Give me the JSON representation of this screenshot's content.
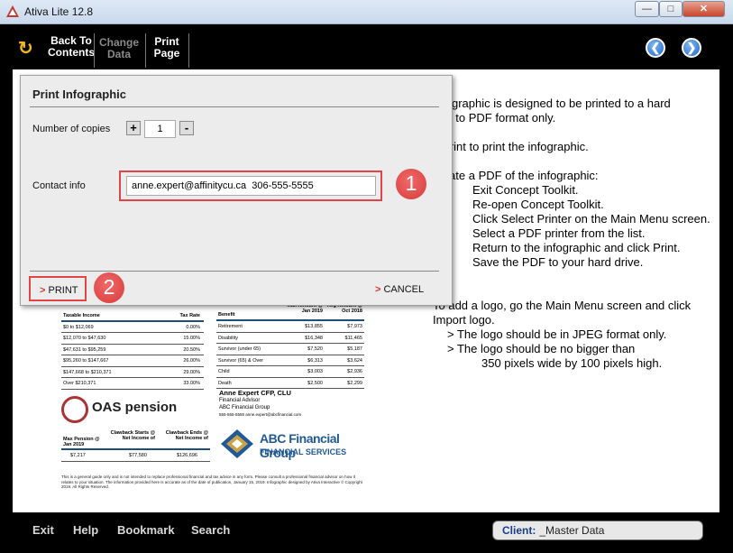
{
  "window": {
    "title": "Ativa Lite 12.8"
  },
  "toolbar": {
    "back_label_1": "Back To",
    "back_label_2": "Contents",
    "change_data_1": "Change",
    "change_data_2": "Data",
    "print_page_1": "Print",
    "print_page_2": "Page"
  },
  "dialog": {
    "title": "Print Infographic",
    "copies_label": "Number of copies",
    "copies_value": "1",
    "contact_label": "Contact info",
    "contact_value": "anne.expert@affinitycu.ca  306-555-5555",
    "badge_1": "1",
    "badge_2": "2",
    "print_label": "PRINT",
    "cancel_label": "CANCEL"
  },
  "instructions": {
    "line_1": "infographic is designed to be printed to a hard",
    "line_2": "y or to PDF format only.",
    "line_3": "k Print to print the infographic.",
    "line_4": "create a PDF of the infographic:",
    "step_1": "Exit Concept Toolkit.",
    "step_2": "Re-open Concept Toolkit.",
    "step_3": "Click Select Printer on the Main Menu screen.",
    "step_4": "Select a PDF printer from the list.",
    "step_5": "Return to the infographic and click Print.",
    "step_6": "Save the PDF to your hard drive.",
    "logo_1": "To add a logo, go the Main Menu screen and click",
    "logo_2": "Import logo.",
    "logo_3": "> The logo should be in JPEG format only.",
    "logo_4": "> The logo should be no bigger than",
    "logo_5": "350 pixels wide by 100 pixels high."
  },
  "infographic": {
    "tax_header": [
      "Taxable Income",
      "Tax Rate"
    ],
    "tax_rows": [
      [
        "$0 to $12,069",
        "0.00%"
      ],
      [
        "$12,070 to $47,630",
        "15.00%"
      ],
      [
        "$47,631 to $95,259",
        "20.50%"
      ],
      [
        "$95,260 to $147,667",
        "26.00%"
      ],
      [
        "$147,668 to $210,371",
        "29.00%"
      ],
      [
        "Over $210,371",
        "33.00%"
      ]
    ],
    "benefit_header": [
      "Benefit",
      "Max Amount @ Jan 2019",
      "Avg Amount @ Oct 2018"
    ],
    "benefit_rows": [
      [
        "Retirement",
        "$13,855",
        "$7,973"
      ],
      [
        "Disability",
        "$16,348",
        "$11,465"
      ],
      [
        "Survivor (under 65)",
        "$7,520",
        "$5,187"
      ],
      [
        "Survivor (65) & Over",
        "$6,313",
        "$3,624"
      ],
      [
        "Child",
        "$3,003",
        "$2,936"
      ],
      [
        "Death",
        "$2,500",
        "$2,299"
      ]
    ],
    "oas_title": "OAS pension",
    "oas_header": [
      "Max Pension @ Jan 2019",
      "Clawback Starts @ Net Income of",
      "Clawback Ends @ Net Income of"
    ],
    "oas_row": [
      "$7,217",
      "$77,580",
      "$126,696"
    ],
    "advisor_name": "Anne Expert CFP, CLU",
    "advisor_role": "Financial Advisor",
    "advisor_company": "ABC Financial Group",
    "advisor_contact": "555-555-5555  anne.expert@abcfinancial.com",
    "logo_name": "ABC Financial Group",
    "logo_sub": "FINANCIAL SERVICES",
    "disclaimer": "This is a general guide only and is not intended to replace professional financial and tax advice in any form. Please consult a professional financial advisor on how it relates to your situation. The information provided here is accurate as of the date of publication, January 15, 2019. Infographic designed by Ativa Interactive © Copyright 2019. All Rights Reserved."
  },
  "bottombar": {
    "exit": "Exit",
    "help": "Help",
    "bookmark": "Bookmark",
    "search": "Search",
    "client_label": "Client:",
    "client_value": "_Master Data"
  }
}
